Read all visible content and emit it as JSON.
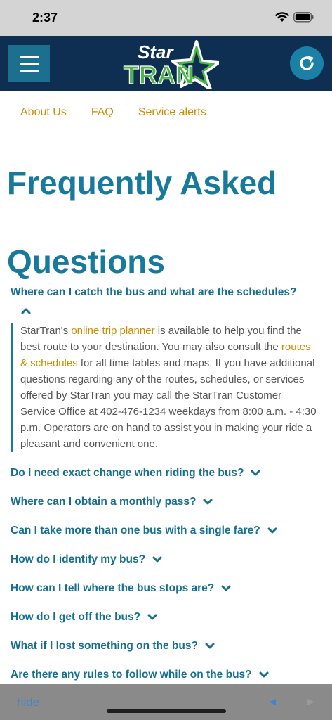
{
  "status_bar": {
    "time": "2:37"
  },
  "header": {
    "logo_text_top": "Star",
    "logo_text_bottom": "TRAN"
  },
  "subnav": {
    "items": [
      "About Us",
      "FAQ",
      "Service alerts"
    ]
  },
  "page": {
    "title": "Frequently Asked Questions"
  },
  "faq": {
    "open": {
      "question": "Where can I catch the bus and what are the schedules?",
      "answer_parts": [
        "StarTran's ",
        "online trip planner",
        " is available to help you find the best route to your destination. You may also consult the ",
        "routes & schedules",
        " for all time tables and maps. If you have additional questions regarding any of the routes, schedules, or services offered by StarTran you may call the StarTran Customer Service Office at 402-476-1234 weekdays from 8:00 a.m. - 4:30 p.m. Operators are on hand to assist you in making your ride a pleasant and convenient one."
      ]
    },
    "questions": [
      "Do I need exact change when riding the bus?",
      "Where can I obtain a monthly pass?",
      "Can I take more than one bus with a single fare?",
      "How do I identify my bus?",
      "How can I tell where the bus stops are?",
      "How do I get off the bus?",
      "What if I lost something on the bus?",
      "Are there any rules to follow while on the bus?"
    ]
  },
  "bottom_bar": {
    "hide_label": "hide"
  },
  "colors": {
    "header_bg": "#0e2e52",
    "accent_teal": "#17799b",
    "link_gold": "#c98c00",
    "logo_green": "#4cb848"
  }
}
